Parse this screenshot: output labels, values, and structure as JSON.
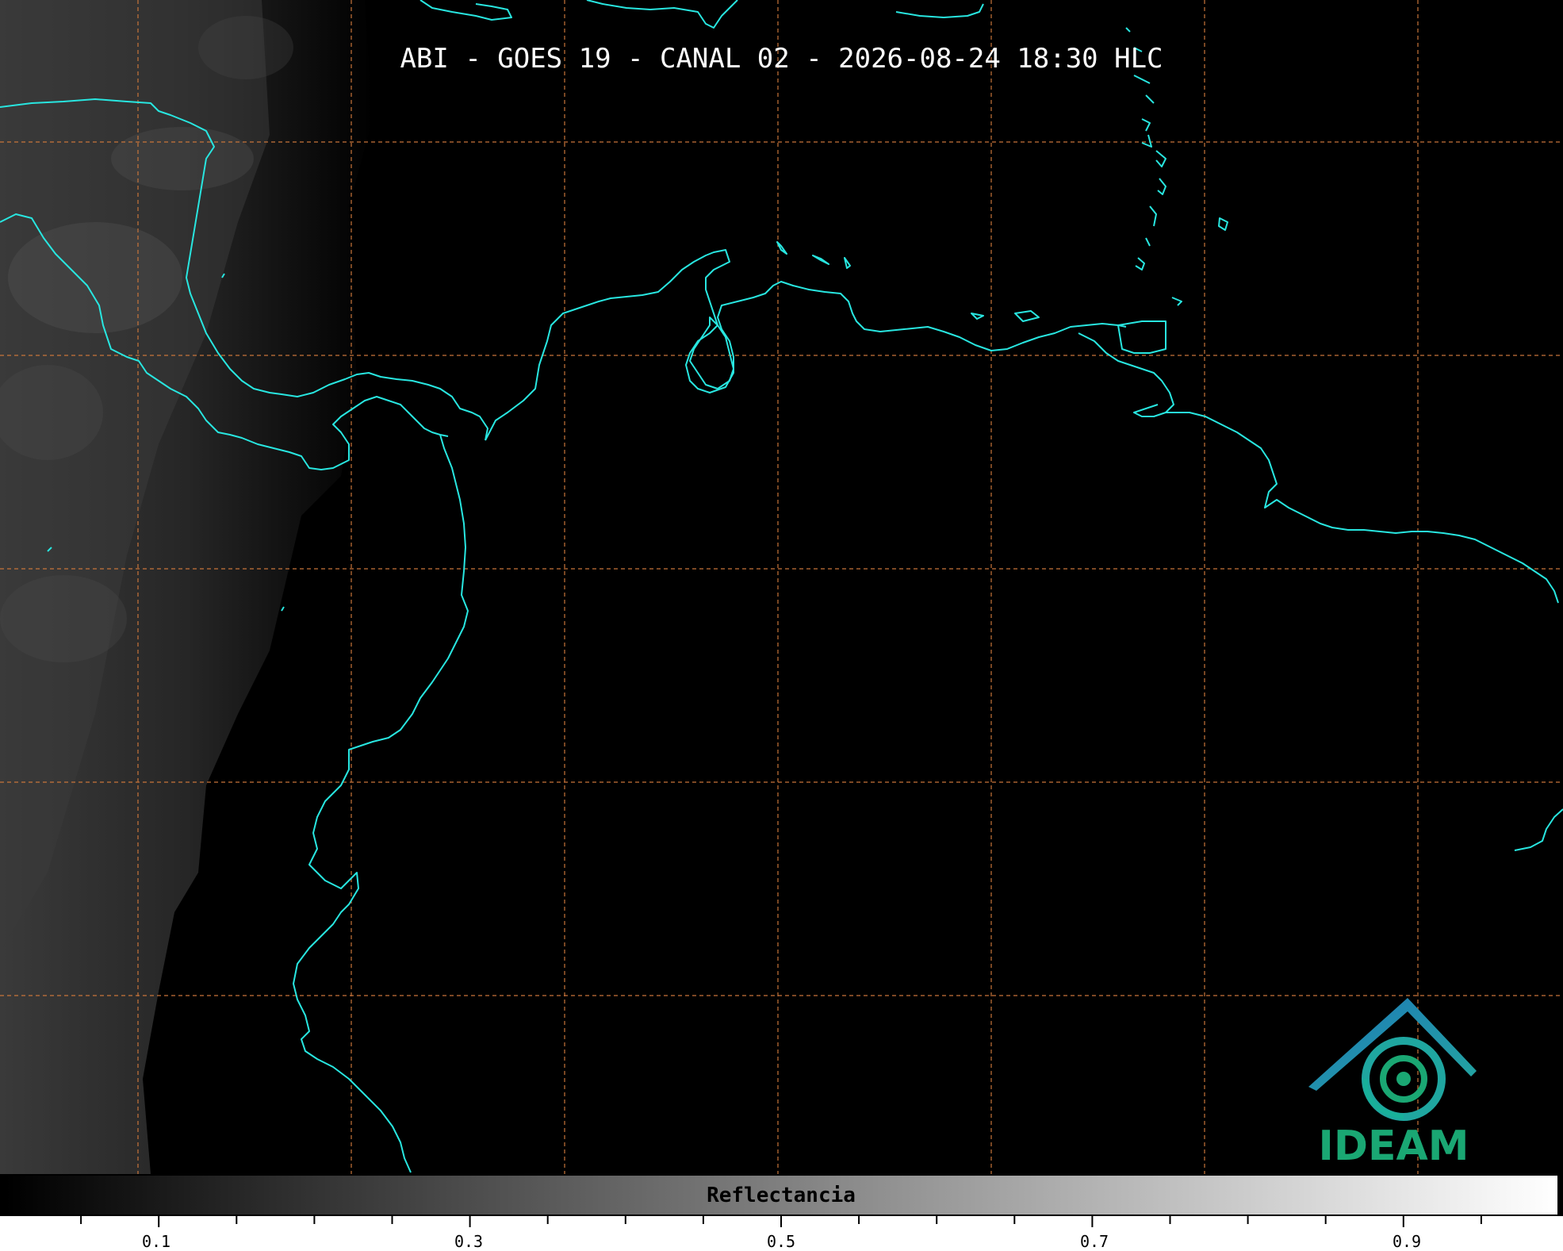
{
  "map": {
    "title": "ABI - GOES 19 - CANAL 02 - 2026-08-24 18:30 HLC",
    "coastline_color": "#28e6e0",
    "grid_color": "#c8743a",
    "background_color": "#000000"
  },
  "colorbar": {
    "label": "Reflectancia",
    "range": [
      0,
      1
    ],
    "gradient": [
      "#000000",
      "#ffffff"
    ],
    "tick_labels": [
      "0.1",
      "0.3",
      "0.5",
      "0.7",
      "0.9"
    ],
    "tick_values": [
      0.1,
      0.3,
      0.5,
      0.7,
      0.9
    ]
  },
  "logo": {
    "text": "IDEAM",
    "color": "#1aa773",
    "icon": "ideam-logo-icon"
  }
}
